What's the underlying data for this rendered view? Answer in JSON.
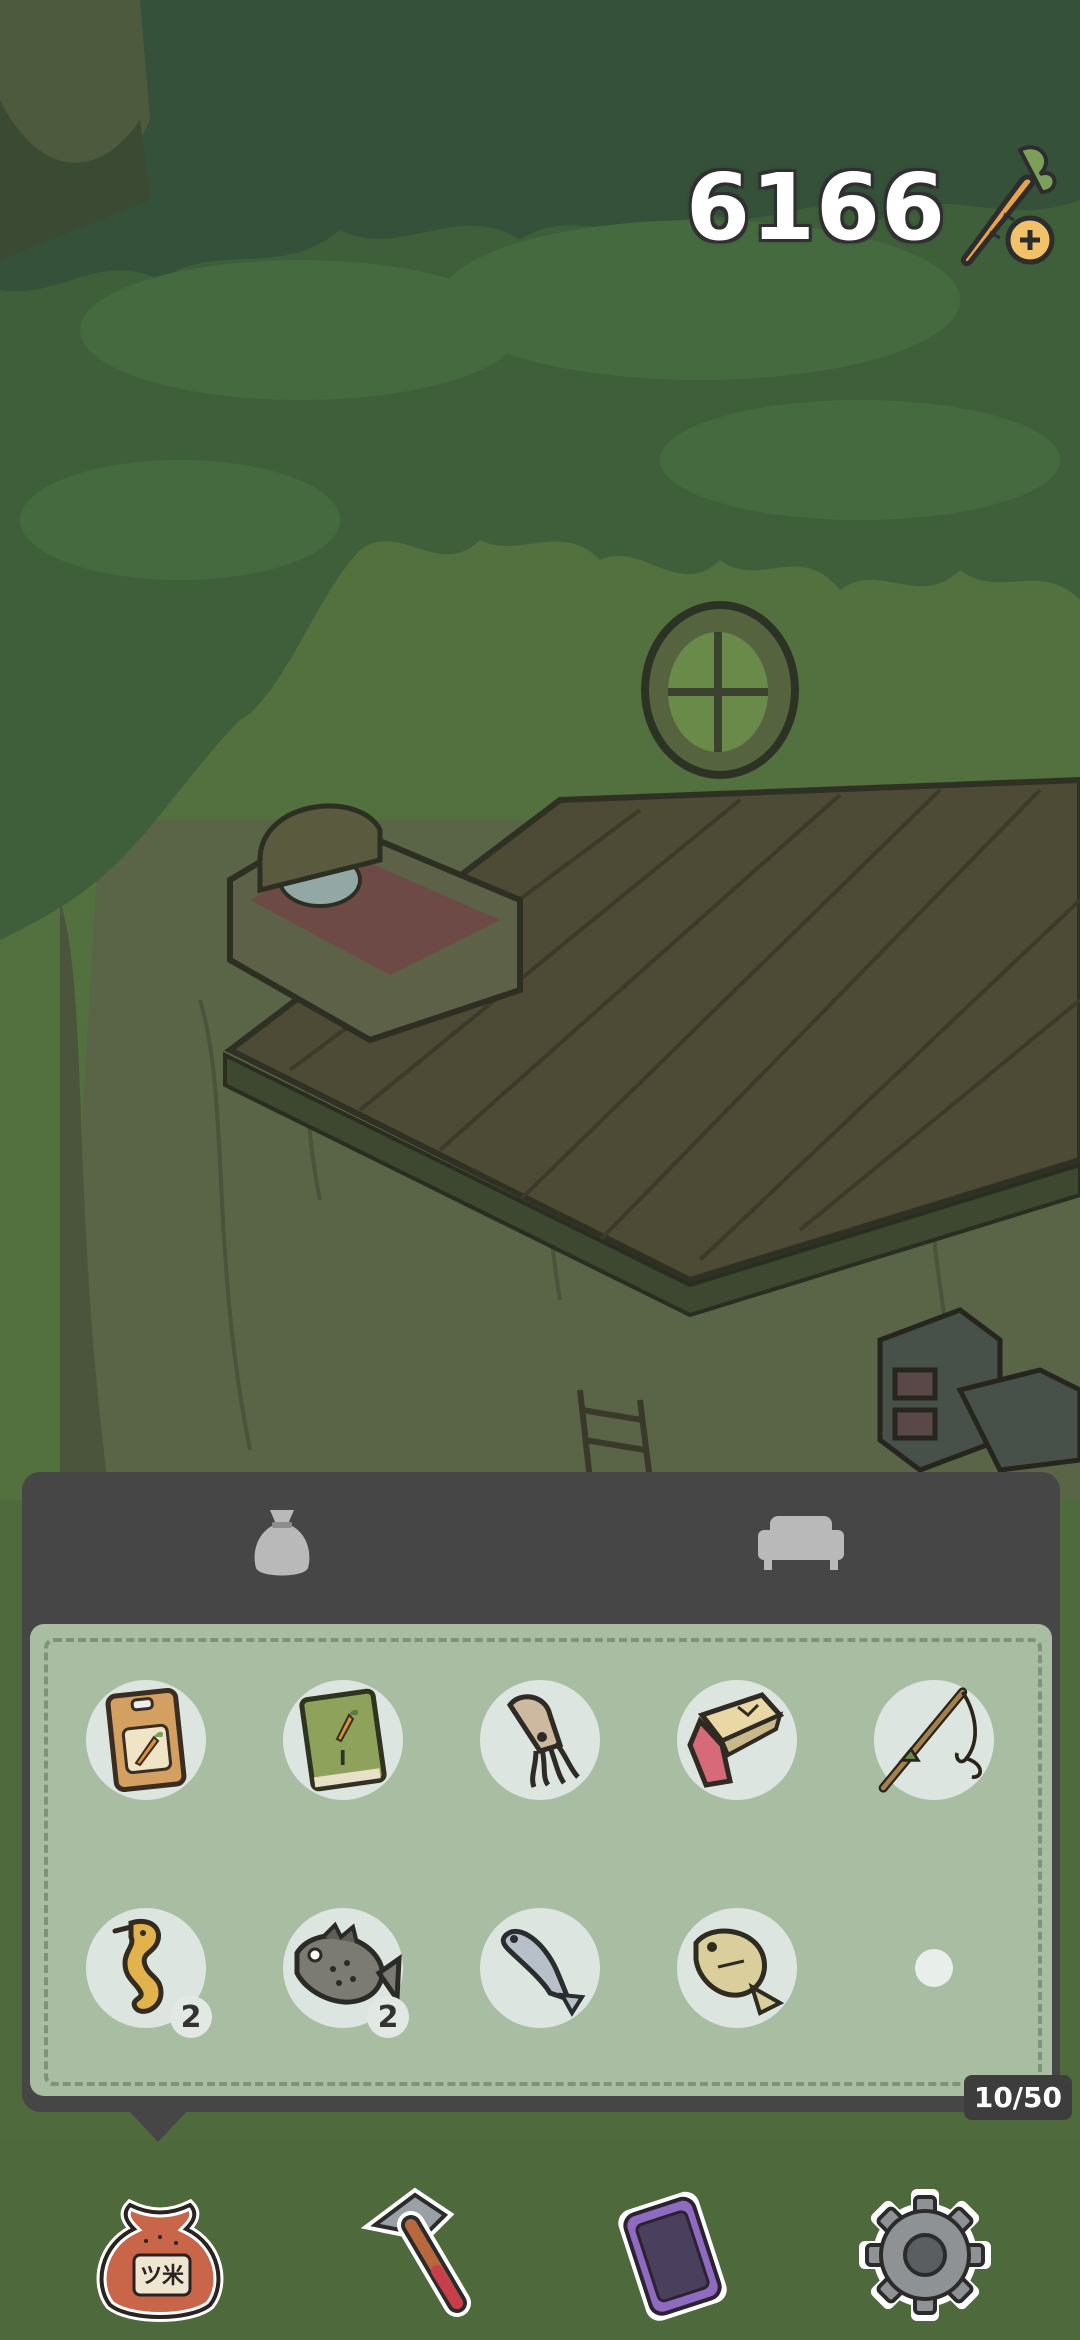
{
  "currency": {
    "amount": "6166",
    "icon": "carrot-plus-icon"
  },
  "inventory": {
    "tabs": [
      {
        "name": "items",
        "icon": "bag-icon",
        "active": true
      },
      {
        "name": "furniture",
        "icon": "sofa-icon",
        "active": false
      }
    ],
    "slots": [
      {
        "icon": "carrot-seed-packet-icon",
        "count": ""
      },
      {
        "icon": "carrot-book-icon",
        "count": ""
      },
      {
        "icon": "squid-icon",
        "count": ""
      },
      {
        "icon": "pink-coupon-ticket-icon",
        "count": ""
      },
      {
        "icon": "fishing-rod-icon",
        "count": ""
      },
      {
        "icon": "seahorse-icon",
        "count": "2"
      },
      {
        "icon": "rockfish-icon",
        "count": "2"
      },
      {
        "icon": "sardine-icon",
        "count": ""
      },
      {
        "icon": "flatfish-icon",
        "count": ""
      },
      {
        "icon": "empty-slot",
        "count": ""
      }
    ],
    "capacity": "10/50"
  },
  "bottom_nav": [
    {
      "name": "bag",
      "icon": "seed-bag-icon",
      "label": "ツ米"
    },
    {
      "name": "build",
      "icon": "hammer-icon"
    },
    {
      "name": "phone",
      "icon": "phone-icon"
    },
    {
      "name": "settings",
      "icon": "gear-icon"
    }
  ],
  "colors": {
    "panel": "#464646",
    "grid": "#a8bda2",
    "slot": "#dde5e0",
    "foliage": "#3e5f3a"
  }
}
